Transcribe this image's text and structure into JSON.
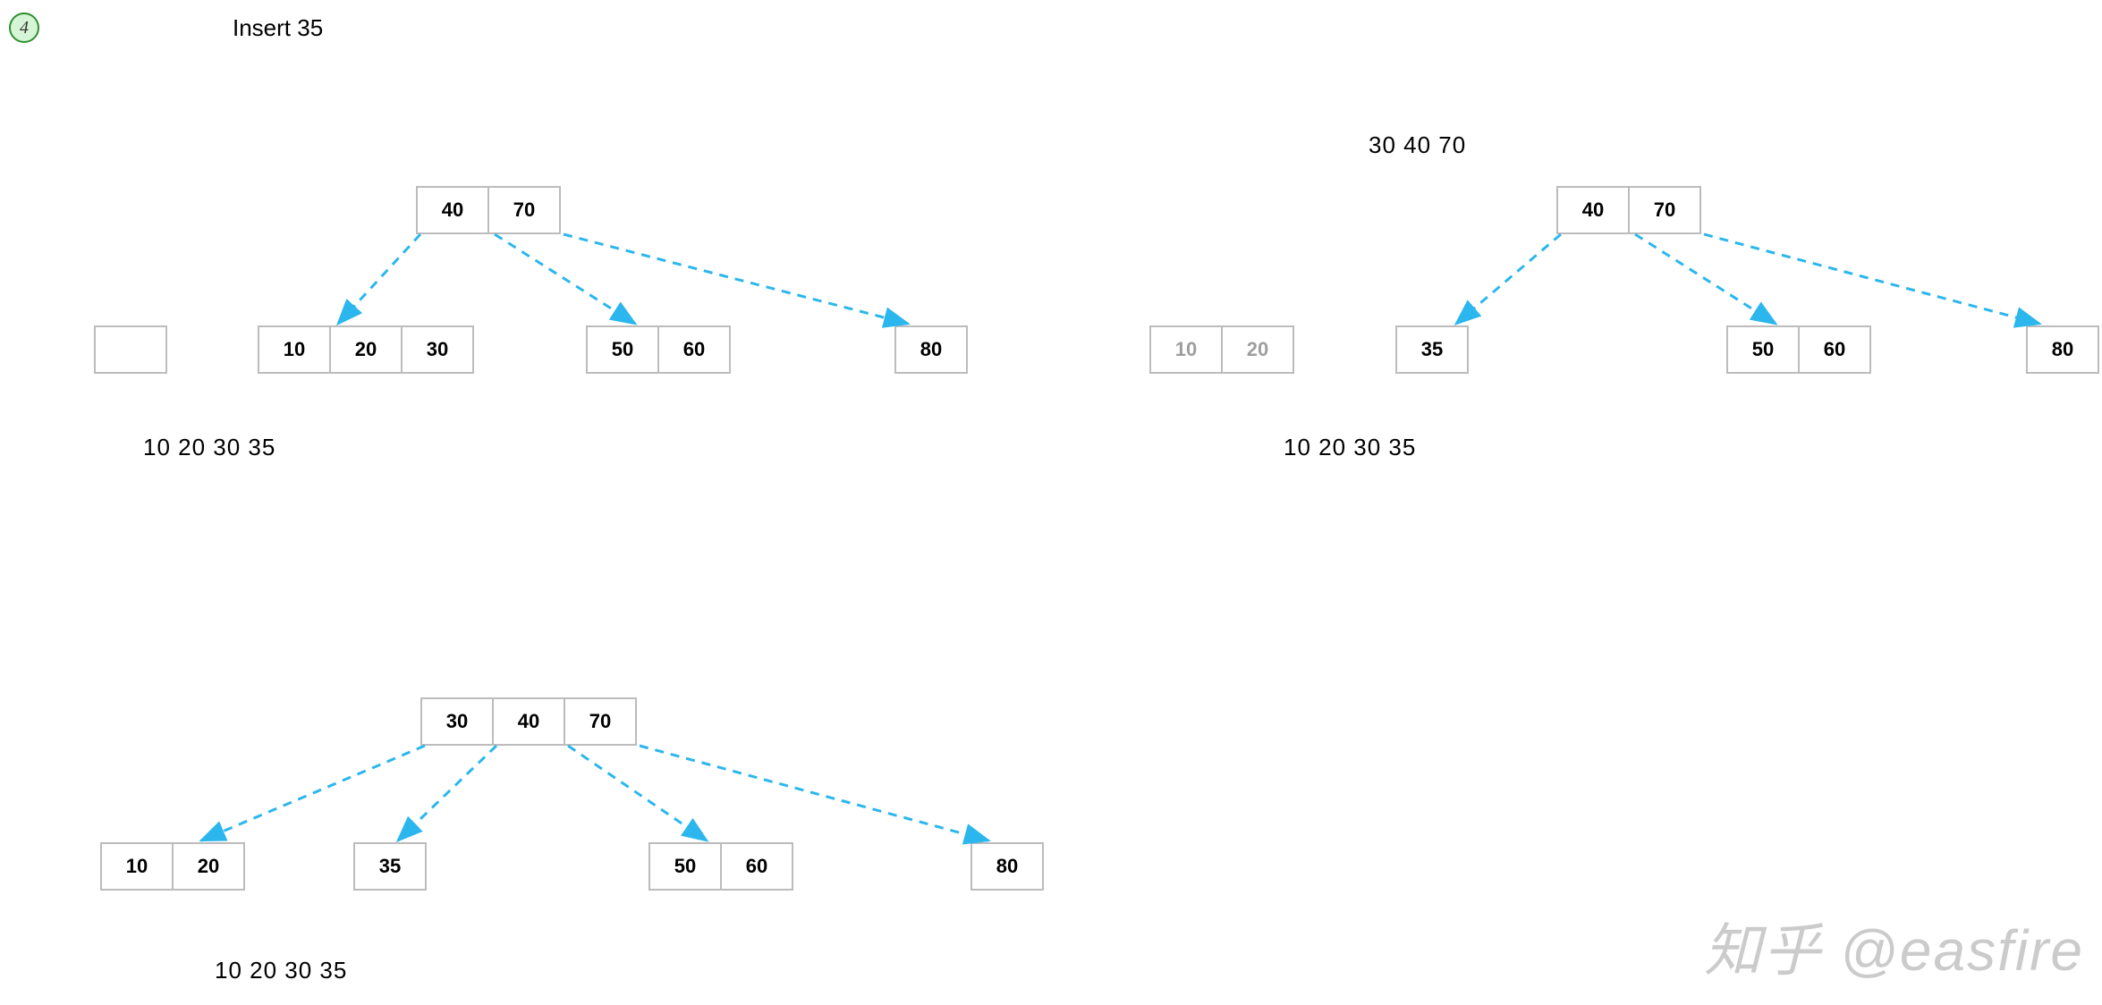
{
  "step": {
    "number": "4",
    "title": "Insert 35"
  },
  "labels": {
    "d1_top": "",
    "d1_bottom": "10 20 30 35",
    "d2_top": "30 40 70",
    "d2_bottom": "10 20 30 35",
    "d3_bottom": "10 20 30 35"
  },
  "d1": {
    "root": [
      "40",
      "70"
    ],
    "child_empty": [
      ""
    ],
    "child_a": [
      "10",
      "20",
      "30"
    ],
    "child_b": [
      "50",
      "60"
    ],
    "child_c": [
      "80"
    ]
  },
  "d2": {
    "root": [
      "40",
      "70"
    ],
    "child_faded": [
      "10",
      "20"
    ],
    "child_a": [
      "35"
    ],
    "child_b": [
      "50",
      "60"
    ],
    "child_c": [
      "80"
    ]
  },
  "d3": {
    "root": [
      "30",
      "40",
      "70"
    ],
    "child_a": [
      "10",
      "20"
    ],
    "child_b": [
      "35"
    ],
    "child_c": [
      "50",
      "60"
    ],
    "child_d": [
      "80"
    ]
  },
  "watermark": "知乎 @easfire",
  "colors": {
    "arrow": "#2bb7ed"
  }
}
